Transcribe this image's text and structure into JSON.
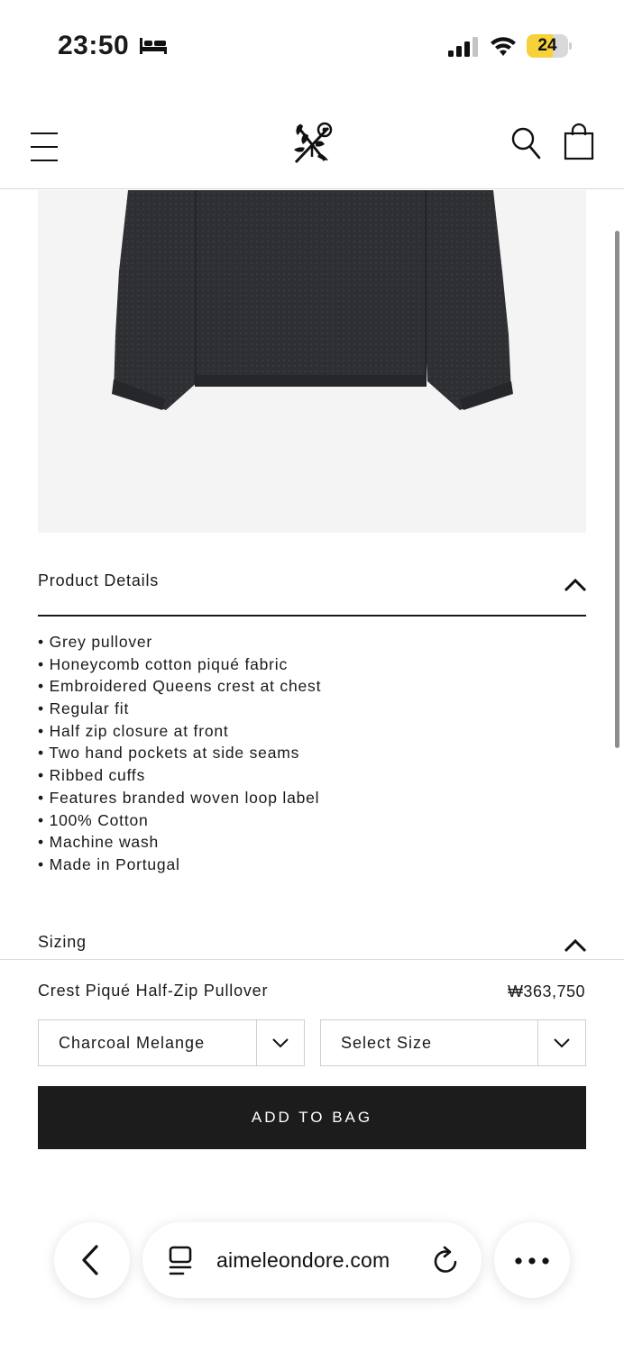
{
  "status_bar": {
    "time": "23:50",
    "battery_level": "24",
    "battery_fraction": 0.24,
    "battery_color": "#f6d13a",
    "icons": [
      "bed-icon",
      "cellular-signal-icon",
      "wifi-icon",
      "battery-icon"
    ]
  },
  "header": {
    "icons": [
      "hamburger-menu-icon",
      "aime-leon-dore-logo-icon",
      "search-icon",
      "shopping-bag-icon"
    ]
  },
  "product_details": {
    "title": "Product Details",
    "expanded": true,
    "items": [
      "• Grey pullover",
      "• Honeycomb cotton piqué fabric",
      "• Embroidered Queens crest at chest",
      "• Regular fit",
      "• Half zip closure at front",
      "• Two hand pockets at side seams",
      "• Ribbed cuffs",
      "• Features branded woven loop label",
      "• 100% Cotton",
      "• Machine wash",
      "• Made in Portugal"
    ]
  },
  "sizing": {
    "title": "Sizing"
  },
  "purchase": {
    "product_name": "Crest Piqué Half-Zip Pullover",
    "price": "₩363,750",
    "color_select": "Charcoal Melange",
    "size_select": "Select Size",
    "add_to_bag": "ADD TO BAG",
    "button_color": "#1c1c1c"
  },
  "browser": {
    "url": "aimeleondore.com",
    "icons": [
      "back-chevron-icon",
      "page-menu-icon",
      "reload-icon",
      "more-icon"
    ]
  }
}
